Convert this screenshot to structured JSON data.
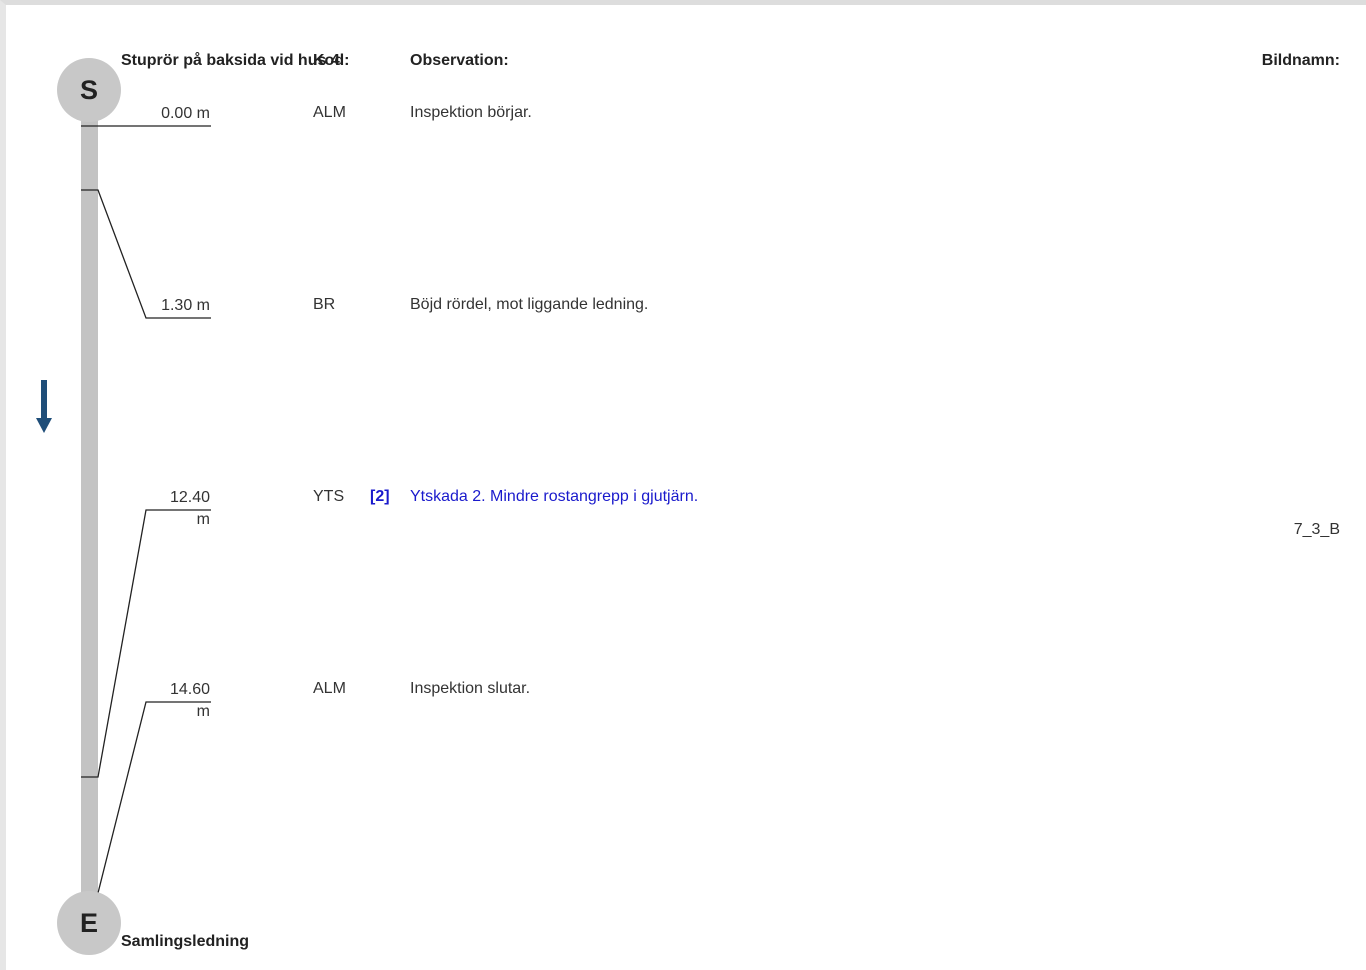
{
  "header": {
    "start_name": "Stuprör på baksida vid hus 4",
    "kod_label": "Kod:",
    "observation_label": "Observation:",
    "bildnamn_label": "Bildnamn:"
  },
  "start_node": {
    "label": "S"
  },
  "end_node": {
    "label": "E",
    "name": "Samlingsledning"
  },
  "direction_icon": "arrow-down",
  "colors": {
    "pipe": "#c3c3c3",
    "node": "#c8c8c8",
    "grade": "#1a1acc",
    "arrow": "#1f4e79"
  },
  "observations": [
    {
      "distance_line1": "0.00 m",
      "distance_line2": "",
      "code": "ALM",
      "grade": "",
      "text": "Inspektion börjar.",
      "image": ""
    },
    {
      "distance_line1": "1.30 m",
      "distance_line2": "",
      "code": "BR",
      "grade": "",
      "text": "Böjd rördel, mot liggande ledning.",
      "image": ""
    },
    {
      "distance_line1": "12.40",
      "distance_line2": "m",
      "code": "YTS",
      "grade": "[2]",
      "text": "Ytskada 2. Mindre rostangrepp i gjutjärn.",
      "image": "7_3_B"
    },
    {
      "distance_line1": "14.60",
      "distance_line2": "m",
      "code": "ALM",
      "grade": "",
      "text": "Inspektion slutar.",
      "image": ""
    }
  ]
}
